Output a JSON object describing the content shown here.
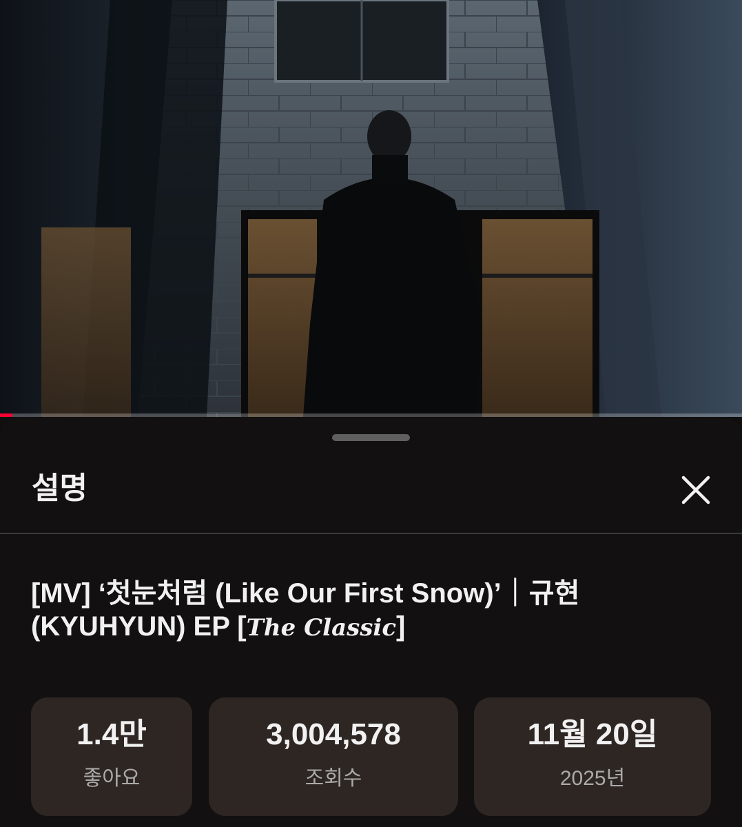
{
  "player": {
    "progress_percent": 1.7
  },
  "panel": {
    "title": "설명",
    "close_icon": "close-icon"
  },
  "video": {
    "title_line1": "[MV] ‘첫눈처럼 (Like Our First Snow)’｜규현",
    "title_line2_prefix": "(KYUHYUN) EP [",
    "title_line2_stylized": "The Classic",
    "title_line2_suffix": "]"
  },
  "stats": {
    "likes": {
      "value": "1.4만",
      "label": "좋아요"
    },
    "views": {
      "value": "3,004,578",
      "label": "조회수"
    },
    "date": {
      "value": "11월 20일",
      "label": "2025년"
    }
  },
  "colors": {
    "background": "#0f0f0f",
    "sheet": "#121010",
    "chip": "#2e2623",
    "progress": "#ff0033"
  }
}
